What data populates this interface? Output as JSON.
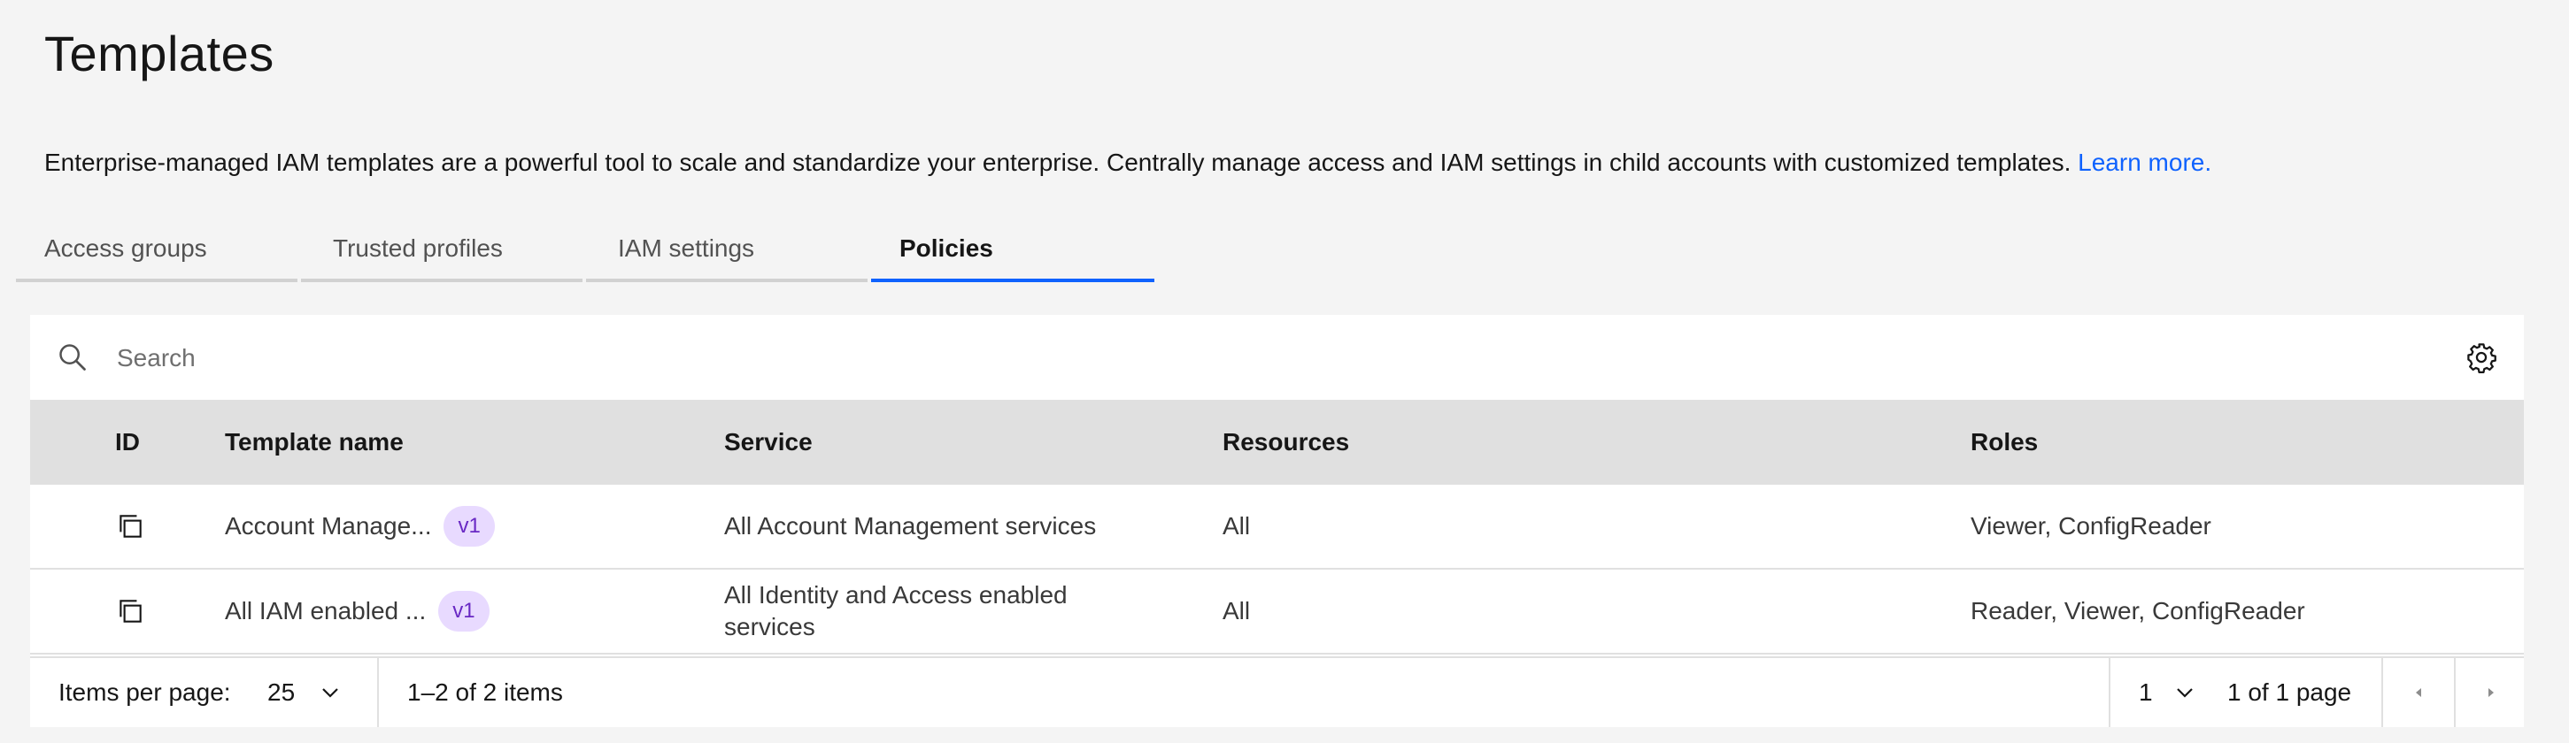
{
  "page": {
    "title": "Templates",
    "description": "Enterprise-managed IAM templates are a powerful tool to scale and standardize your enterprise. Centrally manage access and IAM settings in child accounts with customized templates.",
    "learn_more": "Learn more."
  },
  "tabs": [
    {
      "label": "Access groups",
      "active": false
    },
    {
      "label": "Trusted profiles",
      "active": false
    },
    {
      "label": "IAM settings",
      "active": false
    },
    {
      "label": "Policies",
      "active": true
    }
  ],
  "search": {
    "placeholder": "Search"
  },
  "table": {
    "headers": {
      "id": "ID",
      "template_name": "Template name",
      "service": "Service",
      "resources": "Resources",
      "roles": "Roles"
    },
    "rows": [
      {
        "template_name": "Account Manage...",
        "version": "v1",
        "service": "All Account Management services",
        "resources": "All",
        "roles": "Viewer, ConfigReader"
      },
      {
        "template_name": "All IAM enabled ...",
        "version": "v1",
        "service": "All Identity and Access enabled services",
        "resources": "All",
        "roles": "Reader, Viewer, ConfigReader"
      }
    ]
  },
  "pagination": {
    "items_per_page_label": "Items per page:",
    "items_per_page": "25",
    "range_text": "1–2 of 2 items",
    "page": "1",
    "page_text": "1 of 1 page"
  },
  "icons": {
    "search": "search-icon",
    "settings": "gear-icon",
    "copy": "copy-icon",
    "chevron": "chevron-down-icon",
    "prev": "caret-left-icon",
    "next": "caret-right-icon"
  },
  "colors": {
    "accent": "#0f62fe",
    "badge_bg": "#e8daff",
    "badge_text": "#6929c4",
    "header_bg": "#e0e0e0"
  }
}
